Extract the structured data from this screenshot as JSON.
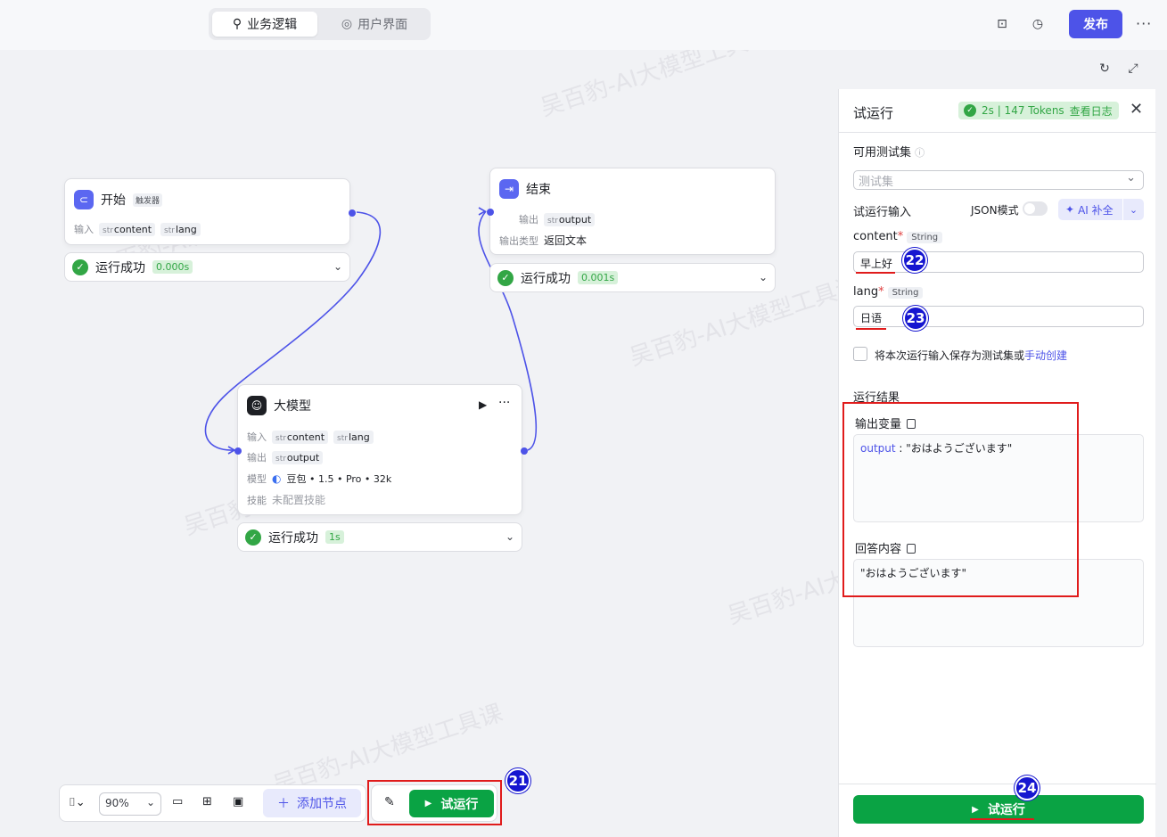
{
  "header": {
    "tab_logic": "业务逻辑",
    "tab_ui": "用户界面",
    "publish_label": "发布"
  },
  "start_node": {
    "title": "开始",
    "tag": "触发器",
    "input_label": "输入",
    "inputs": [
      {
        "type": "str",
        "name": "content"
      },
      {
        "type": "str",
        "name": "lang"
      }
    ],
    "status": "运行成功",
    "time": "0.000s"
  },
  "end_node": {
    "title": "结束",
    "output_label": "输出",
    "output": {
      "type": "str",
      "name": "output"
    },
    "output_type_label": "输出类型",
    "output_type_value": "返回文本",
    "status": "运行成功",
    "time": "0.001s"
  },
  "llm_node": {
    "title": "大模型",
    "input_label": "输入",
    "inputs": [
      {
        "type": "str",
        "name": "content"
      },
      {
        "type": "str",
        "name": "lang"
      }
    ],
    "output_label": "输出",
    "output": {
      "type": "str",
      "name": "output"
    },
    "model_label": "模型",
    "model_value": "豆包 • 1.5 • Pro • 32k",
    "skill_label": "技能",
    "skill_value": "未配置技能",
    "status": "运行成功",
    "time": "1s"
  },
  "toolbar": {
    "zoom": "90%",
    "add_node_label": "添加节点",
    "run_label": "试运行"
  },
  "panel": {
    "title": "试运行",
    "stats": "2s | 147 Tokens",
    "view_log": "查看日志",
    "testset_label": "可用测试集",
    "testset_placeholder": "测试集",
    "trial_input_label": "试运行输入",
    "json_mode_label": "JSON模式",
    "ai_fill_label": "AI 补全",
    "fields": [
      {
        "name": "content",
        "type": "String",
        "value": "早上好"
      },
      {
        "name": "lang",
        "type": "String",
        "value": "日语"
      }
    ],
    "save_text": "将本次运行输入保存为测试集或",
    "save_link": "手动创建",
    "result_label": "运行结果",
    "output_var_label": "输出变量",
    "output_key": "output",
    "output_value": "\"おはようございます\"",
    "answer_label": "回答内容",
    "answer_value": "\"おはようございます\"",
    "run_label": "试运行"
  },
  "markers": [
    "21",
    "22",
    "23",
    "24"
  ],
  "watermark": "吴百豹-AI大模型工具课",
  "colors": {
    "accent": "#4d53e8",
    "success": "#0aa344",
    "highlight": "#e01b1b",
    "marker": "#1616d0"
  }
}
